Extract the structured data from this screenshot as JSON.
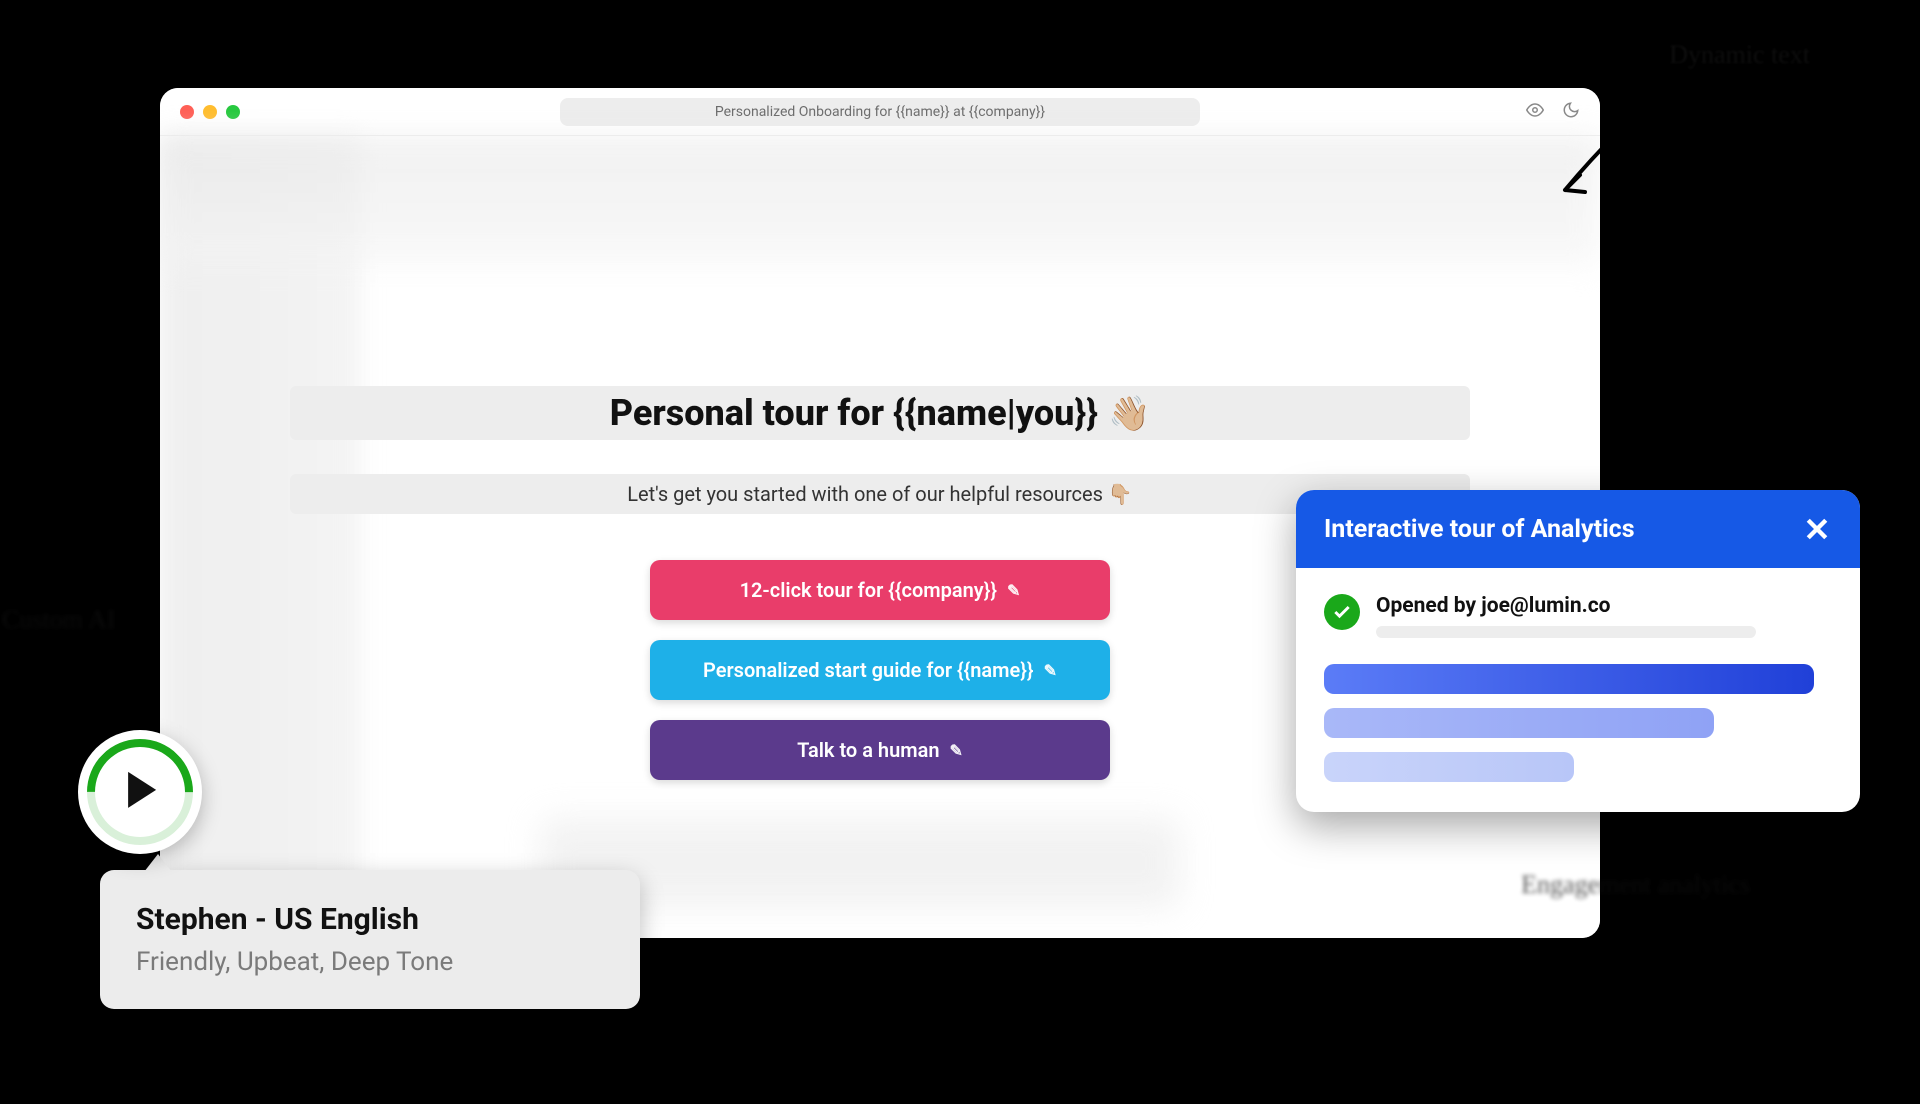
{
  "browser": {
    "title": "Personalized Onboarding for {{name}} at {{company}}"
  },
  "hero": {
    "title": "Personal tour for {{name|you}}",
    "wave": "👋🏼",
    "subtitle": "Let's get you started with one of our helpful resources 👇🏼"
  },
  "cta": {
    "pink": "12-click tour for {{company}}",
    "blue": "Personalized start guide for {{name}}",
    "purple": "Talk to a human"
  },
  "voice": {
    "title": "Stephen - US English",
    "desc": "Friendly, Upbeat, Deep Tone"
  },
  "analytics": {
    "title": "Interactive tour of Analytics",
    "opened": "Opened by joe@lumin.co"
  },
  "annotations": {
    "hand1": "Dynamic text",
    "hand2": "Custom AI",
    "hand3": "Engagement analytics"
  },
  "icons": {
    "eye": "eye-icon",
    "moon": "moon-icon",
    "close": "close-icon",
    "check": "check-icon",
    "play": "play-icon",
    "pencil": "pencil-icon"
  }
}
